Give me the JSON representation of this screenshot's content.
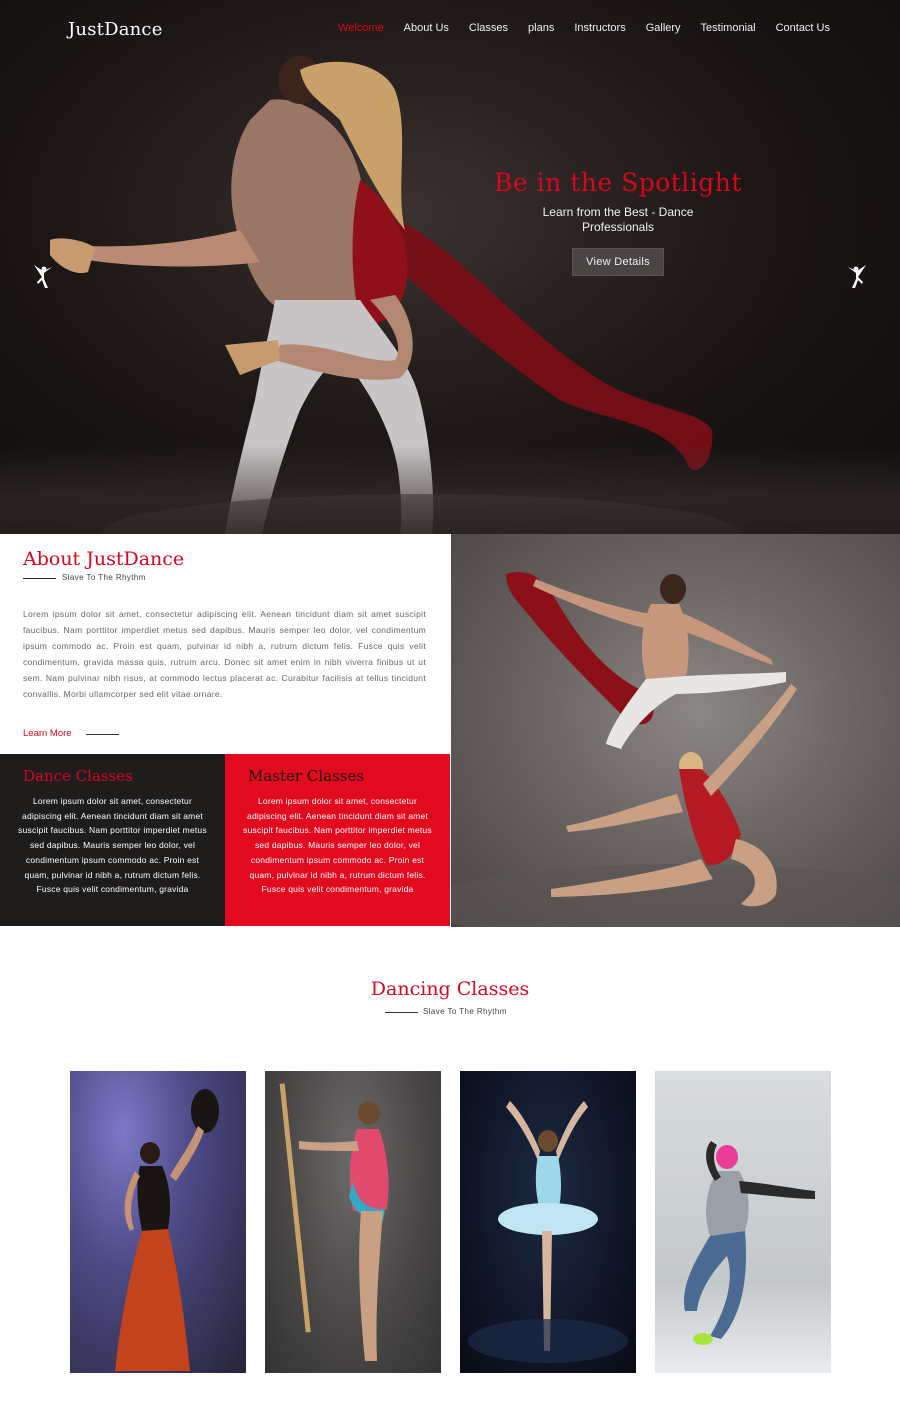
{
  "header": {
    "logo": "JustDance",
    "nav": [
      "Welcome",
      "About Us",
      "Classes",
      "plans",
      "Instructors",
      "Gallery",
      "Testimonial",
      "Contact Us"
    ],
    "active_nav": "Welcome"
  },
  "hero": {
    "title": "Be in the Spotlight",
    "subtitle": "Learn from the Best - Dance Professionals",
    "button": "View Details",
    "prev_icon": "ballerina-icon",
    "next_icon": "ballerina-icon"
  },
  "about": {
    "title": "About JustDance",
    "tagline": "Slave To The Rhythm",
    "body": "Lorem ipsum dolor sit amet, consectetur adipiscing elit. Aenean tincidunt diam sit amet suscipit faucibus. Nam porttitor imperdiet metus sed dapibus. Mauris semper leo dolor, vel condimentum ipsum commodo ac. Proin est quam, pulvinar id nibh a, rutrum dictum felis. Fusce quis velit condimentum, gravida massa quis, rutrum arcu. Donec sit amet enim in nibh viverra finibus ut ut sem. Nam pulvinar nibh risus, at commodo lectus placerat ac. Curabitur facilisis at tellus tincidunt convallis. Morbi ullamcorper sed elit vitae ornare.",
    "learn_more": "Learn More"
  },
  "cards": {
    "dance": {
      "title": "Dance Classes",
      "body": "Lorem ipsum dolor sit amet, consectetur adipiscing elit. Aenean tincidunt diam sit amet suscipit faucibus. Nam porttitor imperdiet metus sed dapibus. Mauris semper leo dolor, vel condimentum ipsum commodo ac. Proin est quam, pulvinar id nibh a, rutrum dictum felis. Fusce quis velit condimentum, gravida"
    },
    "master": {
      "title": "Master Classes",
      "body": "Lorem ipsum dolor sit amet, consectetur adipiscing elit. Aenean tincidunt diam sit amet suscipit faucibus. Nam porttitor imperdiet metus sed dapibus. Mauris semper leo dolor, vel condimentum ipsum commodo ac. Proin est quam, pulvinar id nibh a, rutrum dictum felis. Fusce quis velit condimentum, gravida"
    }
  },
  "dancing_classes": {
    "title": "Dancing Classes",
    "tagline": "Slave To The Rhythm"
  },
  "colors": {
    "accent": "#d8061f",
    "dark_panel": "#1f1c1c",
    "red_panel": "#e10a1e"
  }
}
